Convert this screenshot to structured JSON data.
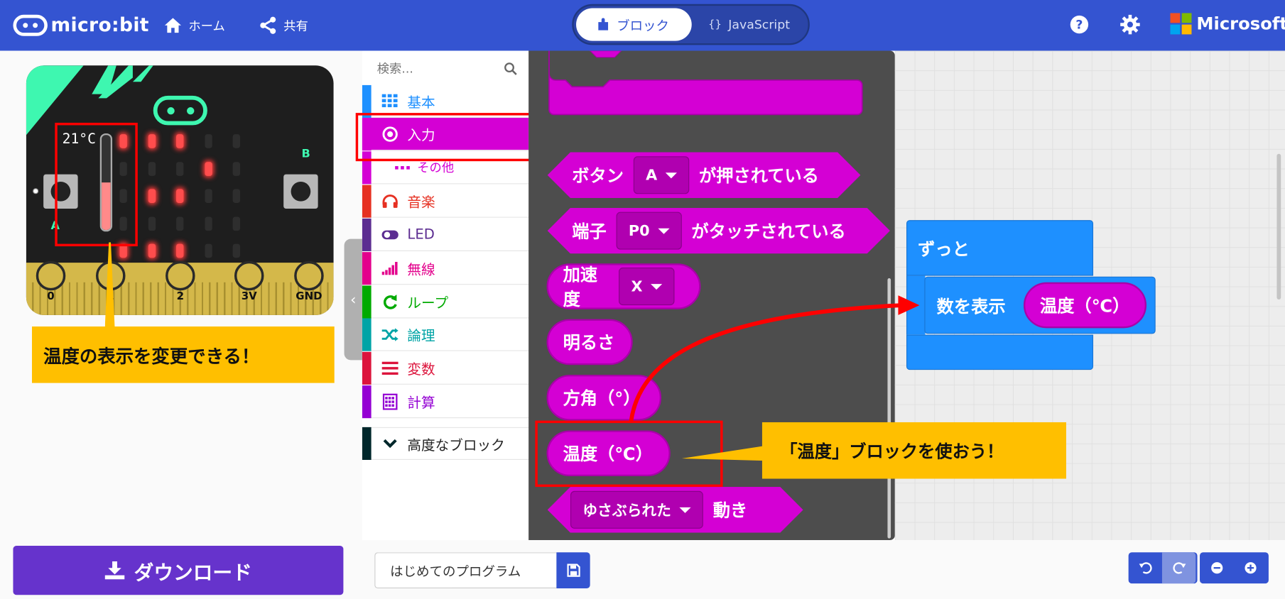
{
  "header": {
    "logo_text": "micro:bit",
    "home_label": "ホーム",
    "share_label": "共有",
    "blocks_tab_label": "ブロック",
    "javascript_tab_label": "JavaScript",
    "javascript_tab_glyph": "{}",
    "brand_label": "Microsoft"
  },
  "simulator": {
    "temperature_readout": "21°C",
    "button_a_label": "A",
    "button_b_label": "B",
    "pin_labels": [
      "0",
      "1",
      "2",
      "3V",
      "GND"
    ],
    "thermometer_level": 0.5,
    "led_matrix": [
      [
        1,
        1,
        1,
        0,
        0
      ],
      [
        0,
        0,
        0,
        1,
        0
      ],
      [
        0,
        1,
        1,
        0,
        0
      ],
      [
        0,
        0,
        0,
        0,
        0
      ],
      [
        1,
        1,
        1,
        0,
        0
      ]
    ]
  },
  "toolbox": {
    "search_placeholder": "検索...",
    "categories": [
      {
        "label": "基本",
        "color": "#1e90ff",
        "icon": "grid-icon"
      },
      {
        "label": "入力",
        "color": "#d400d4",
        "icon": "target-icon",
        "selected": true
      },
      {
        "label": "その他",
        "color": "#d400d4",
        "icon": "more-icon",
        "sub": true
      },
      {
        "label": "音楽",
        "color": "#e63022",
        "icon": "headphones-icon"
      },
      {
        "label": "LED",
        "color": "#5c2d91",
        "icon": "toggle-icon"
      },
      {
        "label": "無線",
        "color": "#e3008c",
        "icon": "signal-icon"
      },
      {
        "label": "ループ",
        "color": "#00aa00",
        "icon": "loop-icon"
      },
      {
        "label": "論理",
        "color": "#00a4a6",
        "icon": "shuffle-icon"
      },
      {
        "label": "変数",
        "color": "#dc143c",
        "icon": "lines-icon"
      },
      {
        "label": "計算",
        "color": "#9400d3",
        "icon": "calculator-icon"
      },
      {
        "label": "高度なブロック",
        "color": "#00272b",
        "icon": "chevron-down-icon"
      }
    ]
  },
  "flyout": {
    "button_block": {
      "prefix": "ボタン",
      "value": "A",
      "suffix": "が押されている"
    },
    "pin_block": {
      "prefix": "端子",
      "value": "P0",
      "suffix": "がタッチされている"
    },
    "accel_block": {
      "prefix": "加速度",
      "value": "X"
    },
    "light_block": "明るさ",
    "compass_block": "方角（°）",
    "temp_block": "温度（℃）",
    "gesture_block": {
      "value": "ゆさぶられた",
      "suffix": "動き"
    }
  },
  "workspace": {
    "forever_label": "ずっと",
    "show_number_label": "数を表示",
    "temp_reporter": "温度（℃）"
  },
  "annotations": {
    "left_callout": "温度の表示を変更できる！",
    "right_callout": "「温度」ブロックを使おう！"
  },
  "bottom": {
    "download_label": "ダウンロード",
    "project_name": "はじめてのプログラム"
  },
  "colors": {
    "header": "#3454d1",
    "input_category": "#d400d4",
    "basic_category": "#1e90ff",
    "callout": "#ffbf00",
    "highlight": "#ff0000",
    "download": "#6633cc"
  }
}
